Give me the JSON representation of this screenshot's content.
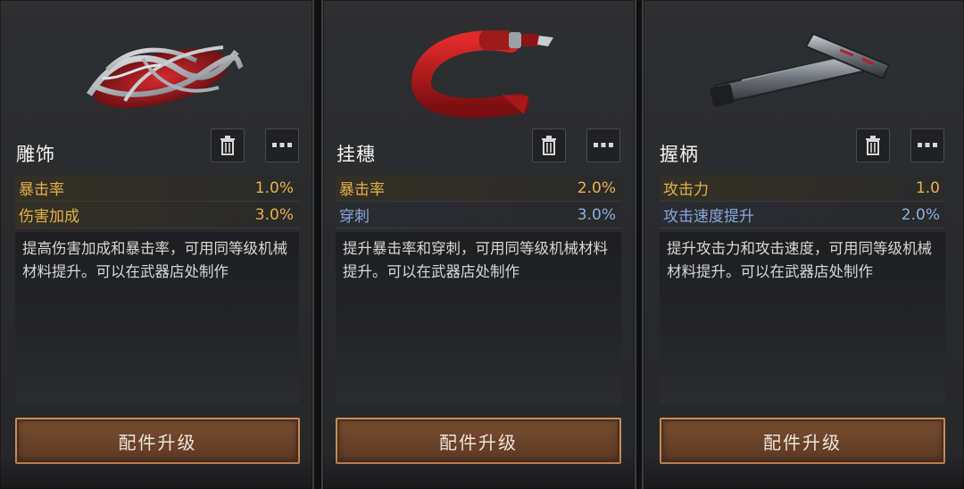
{
  "cards": [
    {
      "name": "雕饰",
      "stats": [
        {
          "label": "暴击率",
          "value": "1.0%",
          "tone": "gold"
        },
        {
          "label": "伤害加成",
          "value": "3.0%",
          "tone": "gold"
        }
      ],
      "description": "提高伤害加成和暴击率，可用同等级机械材料提升。可以在武器店处制作",
      "upgrade_label": "配件升级",
      "delete_icon": "trash-icon",
      "more_icon": "more-dots-icon",
      "art_icon": "ornament-carving"
    },
    {
      "name": "挂穗",
      "stats": [
        {
          "label": "暴击率",
          "value": "2.0%",
          "tone": "gold"
        },
        {
          "label": "穿刺",
          "value": "3.0%",
          "tone": "blue"
        }
      ],
      "description": "提升暴击率和穿刺，可用同等级机械材料提升。可以在武器店处制作",
      "upgrade_label": "配件升级",
      "delete_icon": "trash-icon",
      "more_icon": "more-dots-icon",
      "art_icon": "red-tassel"
    },
    {
      "name": "握柄",
      "stats": [
        {
          "label": "攻击力",
          "value": "1.0",
          "tone": "gold"
        },
        {
          "label": "攻击速度提升",
          "value": "2.0%",
          "tone": "blue"
        }
      ],
      "description": "提升攻击力和攻击速度，可用同等级机械材料提升。可以在武器店处制作",
      "upgrade_label": "配件升级",
      "delete_icon": "trash-icon",
      "more_icon": "more-dots-icon",
      "art_icon": "metal-grip"
    }
  ],
  "colors": {
    "gold_stat": "#e9b24b",
    "blue_stat": "#8fb0de",
    "button_border": "#c88a58",
    "button_fill": "#6a432b"
  }
}
